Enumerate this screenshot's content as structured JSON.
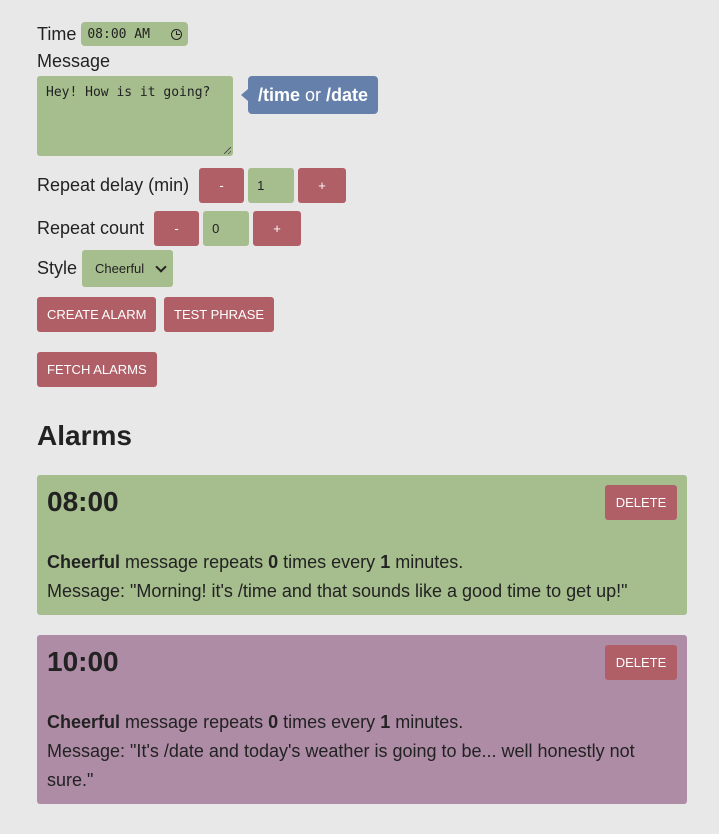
{
  "time": {
    "label": "Time",
    "value": "08:00 AM"
  },
  "message": {
    "label": "Message",
    "value": "Hey! How is it going?"
  },
  "tooltip": {
    "time_token": "/time",
    "or_text": "or",
    "date_token": "/date"
  },
  "repeat_delay": {
    "label": "Repeat delay (min)",
    "minus": "-",
    "value": "1",
    "plus": "+"
  },
  "repeat_count": {
    "label": "Repeat count",
    "minus": "-",
    "value": "0",
    "plus": "+"
  },
  "style": {
    "label": "Style",
    "selected": "Cheerful"
  },
  "buttons": {
    "create": "CREATE ALARM",
    "test": "TEST PHRASE",
    "fetch": "FETCH ALARMS"
  },
  "alarms_heading": "Alarms",
  "alarms": [
    {
      "time": "08:00",
      "delete": "DELETE",
      "style": "Cheerful",
      "repeats_text_a": "message repeats",
      "count": "0",
      "repeats_text_b": "times every",
      "delay": "1",
      "repeats_text_c": "minutes.",
      "message_prefix": "Message: ",
      "message": "\"Morning! it's /time and that sounds like a good time to get up!\"",
      "color": "#a6bd8d"
    },
    {
      "time": "10:00",
      "delete": "DELETE",
      "style": "Cheerful",
      "repeats_text_a": "message repeats",
      "count": "0",
      "repeats_text_b": "times every",
      "delay": "1",
      "repeats_text_c": "minutes.",
      "message_prefix": "Message: ",
      "message": "\"It's /date and today's weather is going to be... well honestly not sure.\"",
      "color": "#ae8ca6"
    }
  ]
}
